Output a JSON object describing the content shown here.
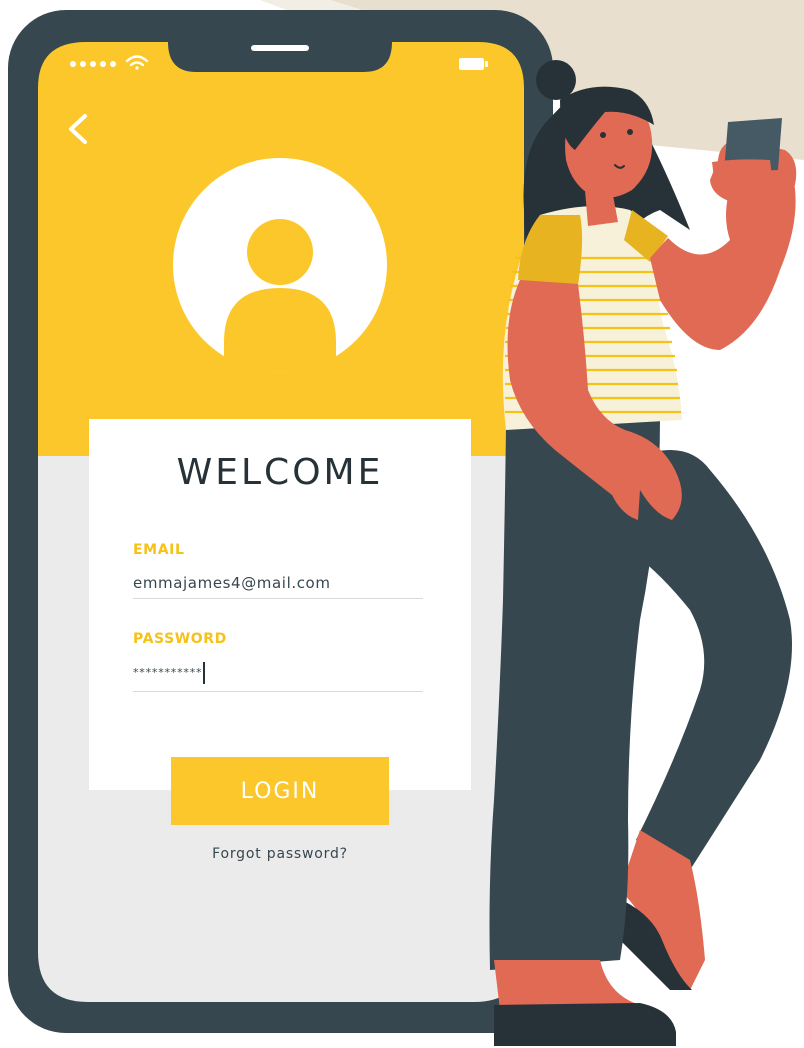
{
  "login_screen": {
    "heading": "WELCOME",
    "email": {
      "label": "EMAIL",
      "value": "emmajames4@mail.com"
    },
    "password": {
      "label": "PASSWORD",
      "value": "***********"
    },
    "login_button_label": "LOGIN",
    "forgot_password_link": "Forgot password?"
  },
  "status_bar": {
    "signal_icon": "signal-dots-icon",
    "wifi_icon": "wifi-icon",
    "battery_icon": "battery-icon"
  },
  "icons": {
    "back": "chevron-left-icon",
    "avatar": "user-avatar-icon"
  },
  "colors": {
    "accent_yellow": "#fcc72b",
    "label_yellow": "#f6c218",
    "phone_frame": "#37474f",
    "dark_text": "#263238",
    "skin": "#e06a53",
    "background_beige": "#e9dfcf"
  }
}
